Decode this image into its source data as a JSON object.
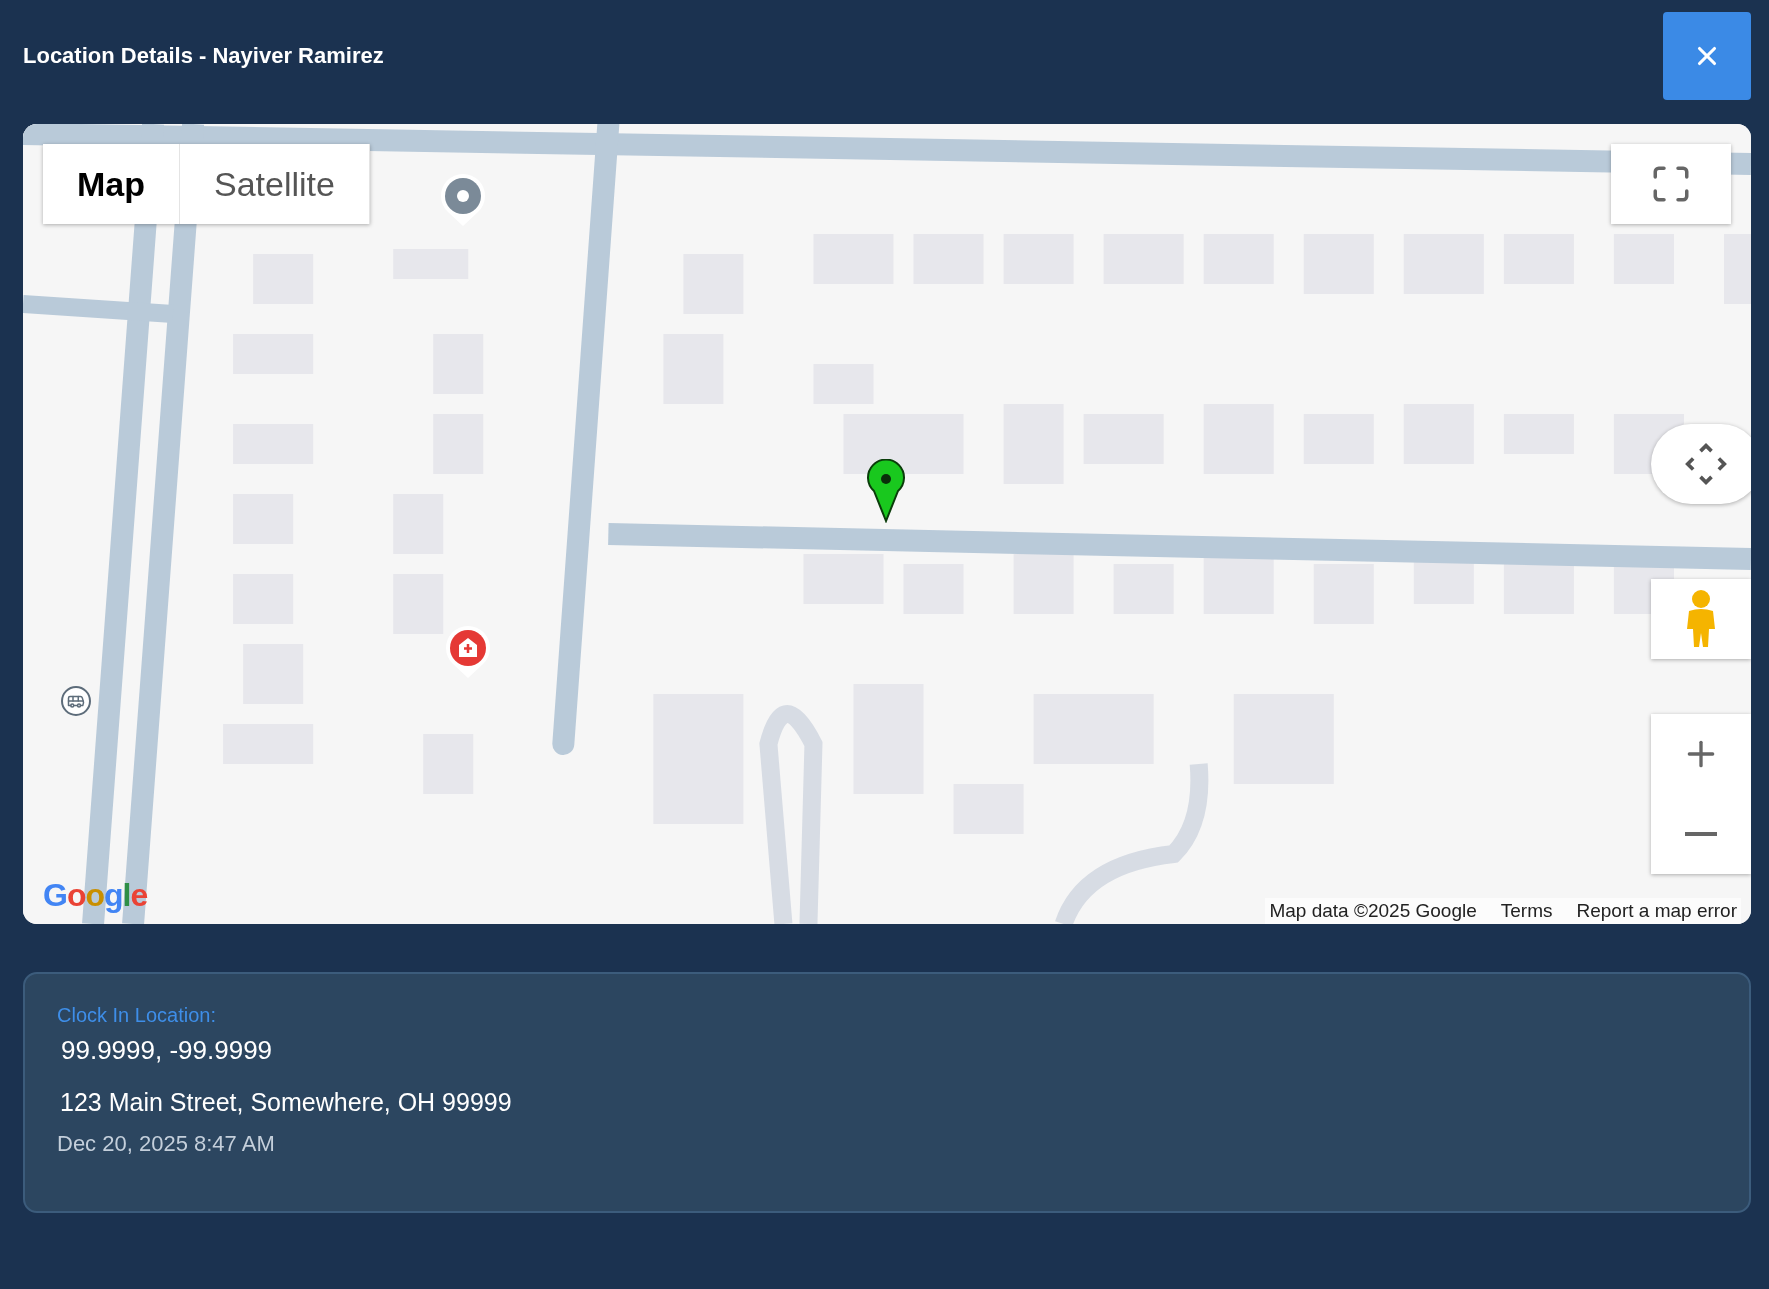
{
  "dialog": {
    "title": "Location Details - Nayiver Ramirez"
  },
  "map": {
    "type_buttons": [
      {
        "label": "Map",
        "selected": true
      },
      {
        "label": "Satellite",
        "selected": false
      }
    ],
    "logo": "Google",
    "attribution": [
      "Map data ©2025 Google",
      "Terms",
      "Report a map error"
    ]
  },
  "clock_in": {
    "label": "Clock In Location:",
    "coordinates": "99.9999, -99.9999",
    "address": "123 Main Street, Somewhere, OH 99999",
    "timestamp": "Dec 20, 2025 8:47 AM"
  }
}
